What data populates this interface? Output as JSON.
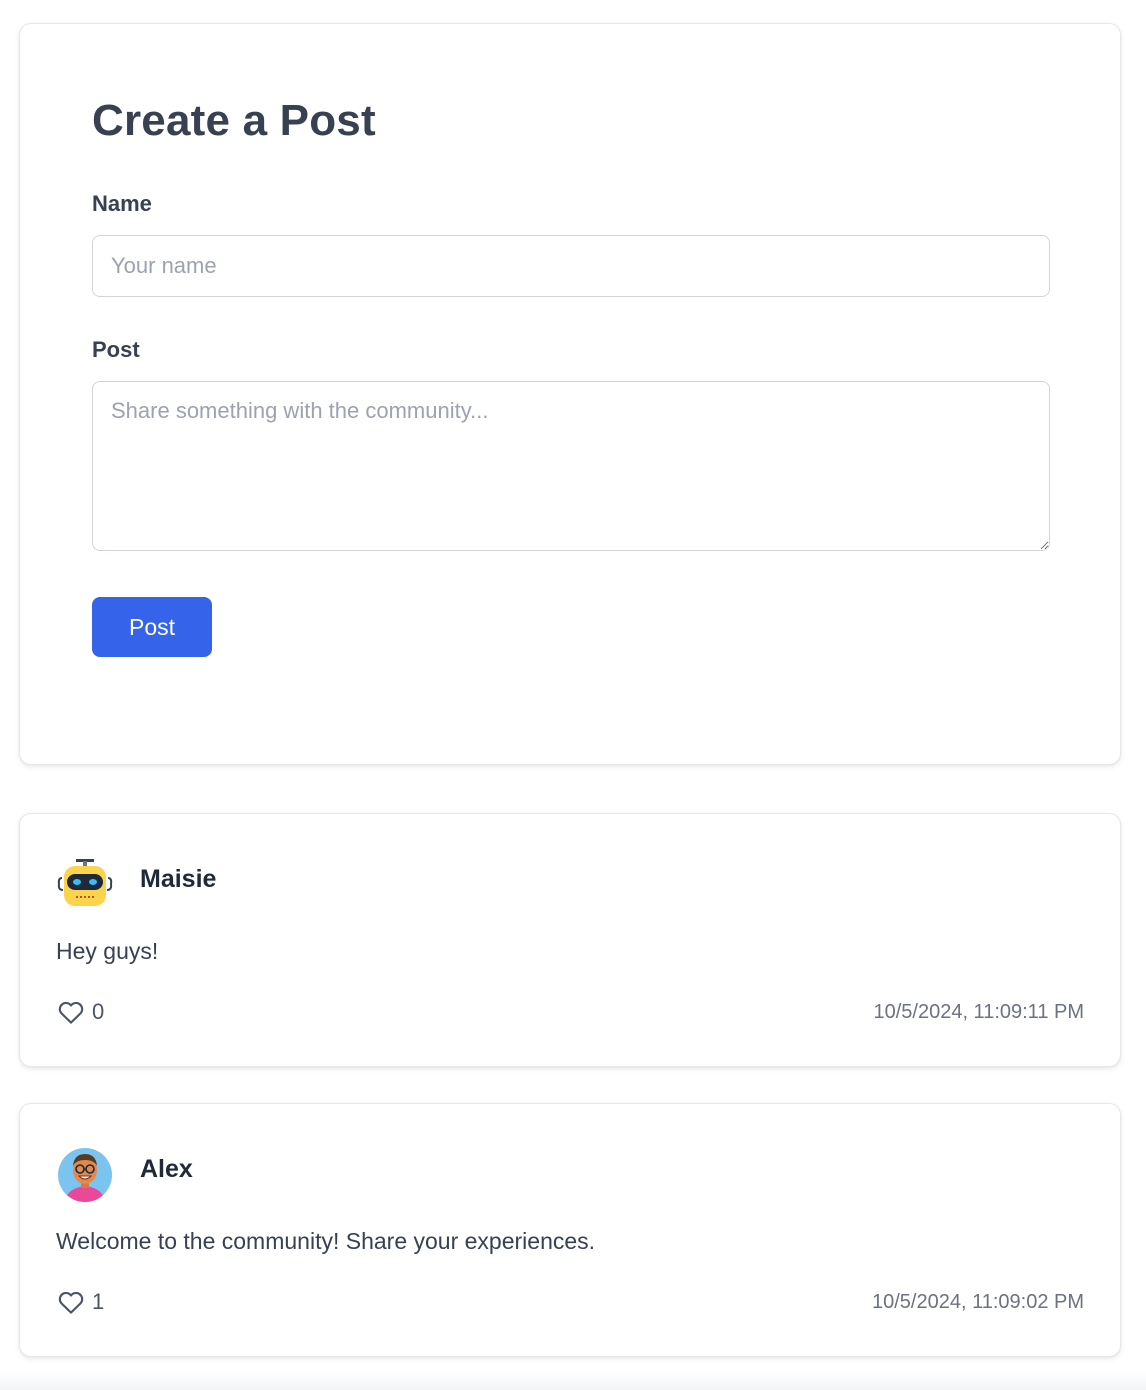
{
  "form": {
    "title": "Create a Post",
    "name_label": "Name",
    "name_placeholder": "Your name",
    "name_value": "",
    "post_label": "Post",
    "post_placeholder": "Share something with the community...",
    "post_value": "",
    "submit_label": "Post",
    "accent_color": "#3563e9"
  },
  "posts": [
    {
      "author": "Maisie",
      "avatar_icon": "robot-avatar-icon",
      "content": "Hey guys!",
      "likes": "0",
      "timestamp": "10/5/2024, 11:09:11 PM"
    },
    {
      "author": "Alex",
      "avatar_icon": "person-glasses-avatar-icon",
      "content": "Welcome to the community! Share your experiences.",
      "likes": "1",
      "timestamp": "10/5/2024, 11:09:02 PM"
    }
  ]
}
